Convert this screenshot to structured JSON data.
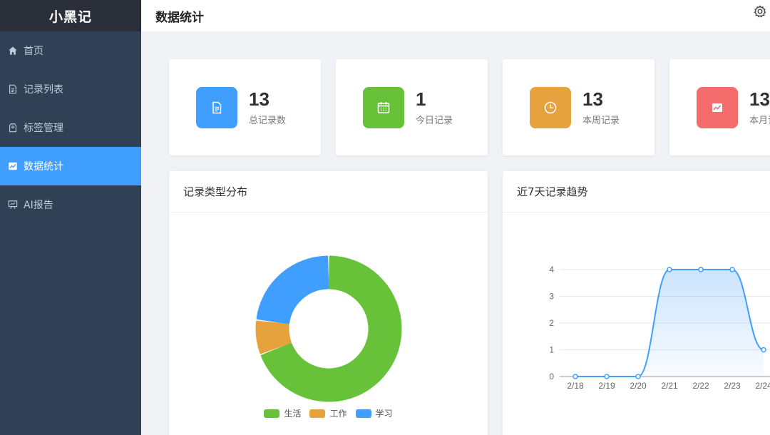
{
  "app": {
    "title": "小黑记"
  },
  "sidebar": {
    "items": [
      {
        "label": "首页",
        "icon": "home-icon",
        "active": false
      },
      {
        "label": "记录列表",
        "icon": "document-icon",
        "active": false
      },
      {
        "label": "标签管理",
        "icon": "tag-icon",
        "active": false
      },
      {
        "label": "数据统计",
        "icon": "chart-icon",
        "active": true
      },
      {
        "label": "AI报告",
        "icon": "presentation-icon",
        "active": false
      }
    ]
  },
  "header": {
    "title": "数据统计",
    "settings_icon": "gear-icon"
  },
  "stats": [
    {
      "value": "13",
      "label": "总记录数",
      "color": "#409eff",
      "icon": "document-icon"
    },
    {
      "value": "1",
      "label": "今日记录",
      "color": "#67c23a",
      "icon": "calendar-icon"
    },
    {
      "value": "13",
      "label": "本周记录",
      "color": "#e6a23c",
      "icon": "clock-icon"
    },
    {
      "value": "13",
      "label": "本月记",
      "color": "#f56c6c",
      "icon": "trend-icon"
    }
  ],
  "pie_card": {
    "title": "记录类型分布"
  },
  "line_card": {
    "title": "近7天记录趋势"
  },
  "chart_data": [
    {
      "type": "pie",
      "title": "",
      "categories": [
        "生活",
        "工作",
        "学习"
      ],
      "values": [
        9,
        1,
        3
      ],
      "colors": [
        "#67c23a",
        "#e6a23c",
        "#409eff"
      ],
      "donut": true,
      "legend": "bottom"
    },
    {
      "type": "line",
      "title": "",
      "x": [
        "2/18",
        "2/19",
        "2/20",
        "2/21",
        "2/22",
        "2/23",
        "2/24"
      ],
      "series": [
        {
          "values": [
            0,
            0,
            0,
            4,
            4,
            4,
            1
          ]
        }
      ],
      "ylim": [
        0,
        4
      ],
      "yticks": [
        "0",
        "1",
        "2",
        "3",
        "4"
      ],
      "area": true,
      "smooth": true,
      "grid": true,
      "color": "#409eff"
    }
  ]
}
